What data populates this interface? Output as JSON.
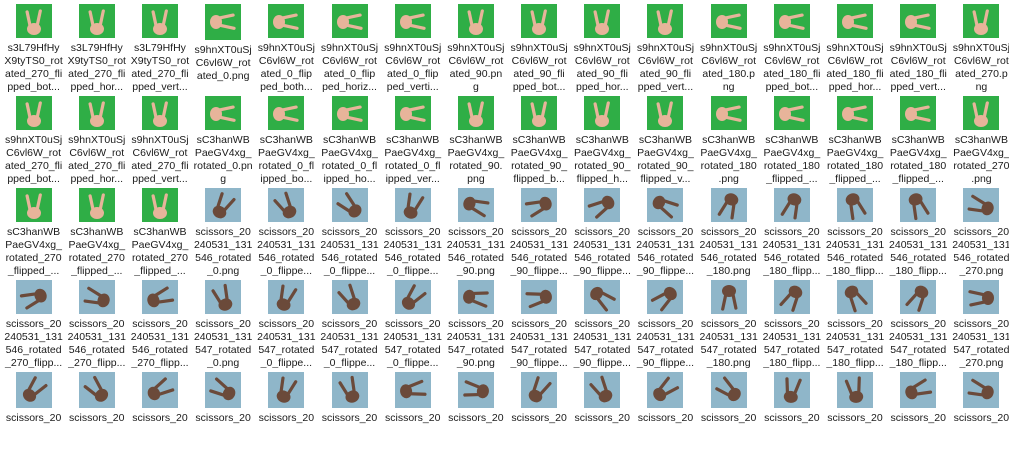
{
  "colors": {
    "green_bg": "#2fae46",
    "green_bg_dark": "#1f9a38",
    "blue_bg": "#8fb6c9",
    "blue_bg_dark": "#6f9cb3",
    "skin": "#e7b49a",
    "skin_dark": "#6b4a3a"
  },
  "files": [
    {
      "label": "s3L79HfHy X9tyTS0_rot ated_270_fli pped_bot...",
      "bg": "green",
      "rot": 0
    },
    {
      "label": "s3L79HfHy X9tyTS0_rot ated_270_fli pped_hor...",
      "bg": "green",
      "rot": 0
    },
    {
      "label": "s3L79HfHy X9tyTS0_rot ated_270_fli pped_vert...",
      "bg": "green",
      "rot": 0
    },
    {
      "label": "s9hnXT0uSj C6vl6W_rot ated_0.png",
      "bg": "green",
      "rot": 90
    },
    {
      "label": "s9hnXT0uSj C6vl6W_rot ated_0_flip ped_both...",
      "bg": "green",
      "rot": 90
    },
    {
      "label": "s9hnXT0uSj C6vl6W_rot ated_0_flip ped_horiz...",
      "bg": "green",
      "rot": 90
    },
    {
      "label": "s9hnXT0uSj C6vl6W_rot ated_0_flip ped_verti...",
      "bg": "green",
      "rot": 90
    },
    {
      "label": "s9hnXT0uSj C6vl6W_rot ated_90.pn g",
      "bg": "green",
      "rot": 0
    },
    {
      "label": "s9hnXT0uSj C6vl6W_rot ated_90_fli pped_bot...",
      "bg": "green",
      "rot": 0
    },
    {
      "label": "s9hnXT0uSj C6vl6W_rot ated_90_fli pped_hor...",
      "bg": "green",
      "rot": 0
    },
    {
      "label": "s9hnXT0uSj C6vl6W_rot ated_90_fli pped_vert...",
      "bg": "green",
      "rot": 0
    },
    {
      "label": "s9hnXT0uSj C6vl6W_rot ated_180.p ng",
      "bg": "green",
      "rot": 90
    },
    {
      "label": "s9hnXT0uSj C6vl6W_rot ated_180_fli pped_bot...",
      "bg": "green",
      "rot": 90
    },
    {
      "label": "s9hnXT0uSj C6vl6W_rot ated_180_fli pped_hor...",
      "bg": "green",
      "rot": 90
    },
    {
      "label": "s9hnXT0uSj C6vl6W_rot ated_180_fli pped_vert...",
      "bg": "green",
      "rot": 90
    },
    {
      "label": "s9hnXT0uSj C6vl6W_rot ated_270.p ng",
      "bg": "green",
      "rot": 0
    },
    {
      "label": "s9hnXT0uSj C6vl6W_rot ated_270_fli pped_bot...",
      "bg": "green",
      "rot": 0
    },
    {
      "label": "s9hnXT0uSj C6vl6W_rot ated_270_fli pped_hor...",
      "bg": "green",
      "rot": 0
    },
    {
      "label": "s9hnXT0uSj C6vl6W_rot ated_270_fli pped_vert...",
      "bg": "green",
      "rot": 0
    },
    {
      "label": "sC3hanWB PaeGV4xg_ rotated_0.png",
      "bg": "green",
      "rot": 90
    },
    {
      "label": "sC3hanWB PaeGV4xg_ rotated_0_fl ipped_bo...",
      "bg": "green",
      "rot": 90
    },
    {
      "label": "sC3hanWB PaeGV4xg_ rotated_0_fl ipped_ho...",
      "bg": "green",
      "rot": 90
    },
    {
      "label": "sC3hanWB PaeGV4xg_ rotated_0_fl ipped_ver...",
      "bg": "green",
      "rot": 90
    },
    {
      "label": "sC3hanWB PaeGV4xg_ rotated_90. png",
      "bg": "green",
      "rot": 0
    },
    {
      "label": "sC3hanWB PaeGV4xg_ rotated_90_ flipped_b...",
      "bg": "green",
      "rot": 0
    },
    {
      "label": "sC3hanWB PaeGV4xg_ rotated_90_ flipped_h...",
      "bg": "green",
      "rot": 0
    },
    {
      "label": "sC3hanWB PaeGV4xg_ rotated_90_ flipped_v...",
      "bg": "green",
      "rot": 0
    },
    {
      "label": "sC3hanWB PaeGV4xg_ rotated_180 .png",
      "bg": "green",
      "rot": 90
    },
    {
      "label": "sC3hanWB PaeGV4xg_ rotated_180 _flipped_...",
      "bg": "green",
      "rot": 90
    },
    {
      "label": "sC3hanWB PaeGV4xg_ rotated_180 _flipped_...",
      "bg": "green",
      "rot": 90
    },
    {
      "label": "sC3hanWB PaeGV4xg_ rotated_180 _flipped_...",
      "bg": "green",
      "rot": 90
    },
    {
      "label": "sC3hanWB PaeGV4xg_ rotated_270 .png",
      "bg": "green",
      "rot": 0
    },
    {
      "label": "sC3hanWB PaeGV4xg_ rotated_270 _flipped_...",
      "bg": "green",
      "rot": 0
    },
    {
      "label": "sC3hanWB PaeGV4xg_ rotated_270 _flipped_...",
      "bg": "green",
      "rot": 0
    },
    {
      "label": "sC3hanWB PaeGV4xg_ rotated_270 _flipped_...",
      "bg": "green",
      "rot": 0
    },
    {
      "label": "scissors_20 240531_131 546_rotated _0.png",
      "bg": "blue",
      "rot": 30
    },
    {
      "label": "scissors_20 240531_131 546_rotated _0_flippe...",
      "bg": "blue",
      "rot": -30
    },
    {
      "label": "scissors_20 240531_131 546_rotated _0_flippe...",
      "bg": "blue",
      "rot": -45
    },
    {
      "label": "scissors_20 240531_131 546_rotated _0_flippe...",
      "bg": "blue",
      "rot": 20
    },
    {
      "label": "scissors_20 240531_131 546_rotated _90.png",
      "bg": "blue",
      "rot": 110
    },
    {
      "label": "scissors_20 240531_131 546_rotated _90_flippe...",
      "bg": "blue",
      "rot": -110
    },
    {
      "label": "scissors_20 240531_131 546_rotated _90_flippe...",
      "bg": "blue",
      "rot": -120
    },
    {
      "label": "scissors_20 240531_131 546_rotated _90_flippe...",
      "bg": "blue",
      "rot": 120
    },
    {
      "label": "scissors_20 240531_131 546_rotated _180.png",
      "bg": "blue",
      "rot": 200
    },
    {
      "label": "scissors_20 240531_131 546_rotated _180_flipp...",
      "bg": "blue",
      "rot": -160
    },
    {
      "label": "scissors_20 240531_131 546_rotated _180_flipp...",
      "bg": "blue",
      "rot": 160
    },
    {
      "label": "scissors_20 240531_131 546_rotated _180_flipp...",
      "bg": "blue",
      "rot": -200
    },
    {
      "label": "scissors_20 240531_131 546_rotated _270.png",
      "bg": "blue",
      "rot": 290
    },
    {
      "label": "scissors_20 240531_131 546_rotated _270_flipp...",
      "bg": "blue",
      "rot": 250
    },
    {
      "label": "scissors_20 240531_131 546_rotated _270_flipp...",
      "bg": "blue",
      "rot": -70
    },
    {
      "label": "scissors_20 240531_131 546_rotated _270_flipp...",
      "bg": "blue",
      "rot": 70
    },
    {
      "label": "scissors_20 240531_131 547_rotated _0.png",
      "bg": "blue",
      "rot": -20
    },
    {
      "label": "scissors_20 240531_131 547_rotated _0_flippe...",
      "bg": "blue",
      "rot": 20
    },
    {
      "label": "scissors_20 240531_131 547_rotated _0_flippe...",
      "bg": "blue",
      "rot": -30
    },
    {
      "label": "scissors_20 240531_131 547_rotated _0_flippe...",
      "bg": "blue",
      "rot": 40
    },
    {
      "label": "scissors_20 240531_131 547_rotated _90.png",
      "bg": "blue",
      "rot": 100
    },
    {
      "label": "scissors_20 240531_131 547_rotated _90_flippe...",
      "bg": "blue",
      "rot": -100
    },
    {
      "label": "scissors_20 240531_131 547_rotated _90_flippe...",
      "bg": "blue",
      "rot": 130
    },
    {
      "label": "scissors_20 240531_131 547_rotated _90_flippe...",
      "bg": "blue",
      "rot": -130
    },
    {
      "label": "scissors_20 240531_131 547_rotated _180.png",
      "bg": "blue",
      "rot": 180
    },
    {
      "label": "scissors_20 240531_131 547_rotated _180_flipp...",
      "bg": "blue",
      "rot": -150
    },
    {
      "label": "scissors_20 240531_131 547_rotated _180_flipp...",
      "bg": "blue",
      "rot": 150
    },
    {
      "label": "scissors_20 240531_131 547_rotated _180_flipp...",
      "bg": "blue",
      "rot": 210
    },
    {
      "label": "scissors_20 240531_131 547_rotated _270.png",
      "bg": "blue",
      "rot": 270
    },
    {
      "label": "scissors_20",
      "bg": "blue",
      "rot": 40
    },
    {
      "label": "scissors_20",
      "bg": "blue",
      "rot": -40
    },
    {
      "label": "scissors_20",
      "bg": "blue",
      "rot": 60
    },
    {
      "label": "scissors_20",
      "bg": "blue",
      "rot": -60
    },
    {
      "label": "scissors_20",
      "bg": "blue",
      "rot": 20
    },
    {
      "label": "scissors_20",
      "bg": "blue",
      "rot": -20
    },
    {
      "label": "scissors_20",
      "bg": "blue",
      "rot": 80
    },
    {
      "label": "scissors_20",
      "bg": "blue",
      "rot": -80
    },
    {
      "label": "scissors_20",
      "bg": "blue",
      "rot": 30
    },
    {
      "label": "scissors_20",
      "bg": "blue",
      "rot": -30
    },
    {
      "label": "scissors_20",
      "bg": "blue",
      "rot": 50
    },
    {
      "label": "scissors_20",
      "bg": "blue",
      "rot": -50
    },
    {
      "label": "scissors_20",
      "bg": "blue",
      "rot": 10
    },
    {
      "label": "scissors_20",
      "bg": "blue",
      "rot": -10
    },
    {
      "label": "scissors_20",
      "bg": "blue",
      "rot": 70
    },
    {
      "label": "scissors_20",
      "bg": "blue",
      "rot": -70
    }
  ]
}
